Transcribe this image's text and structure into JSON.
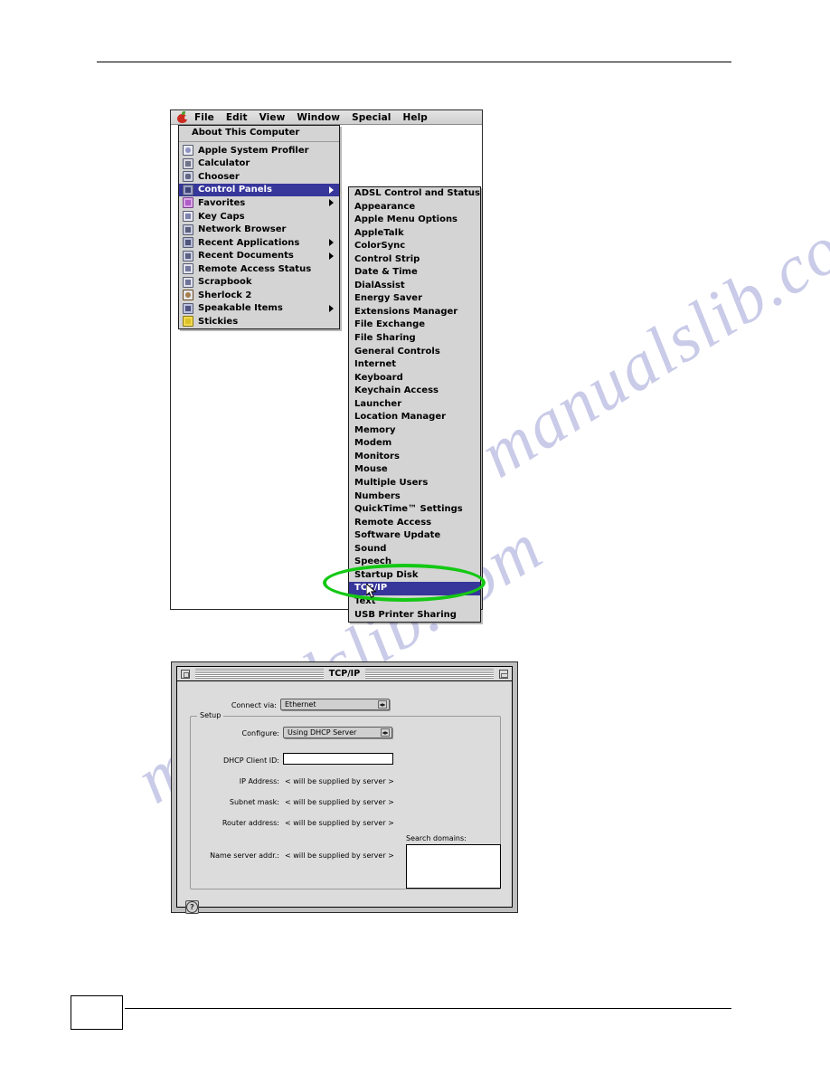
{
  "page": {
    "page_number": ""
  },
  "watermark": {
    "line1": "manualslib.com",
    "line2": "manualslib.com"
  },
  "mac_desktop": {
    "menubar": {
      "apple_icon": "apple-logo-icon",
      "items": [
        "File",
        "Edit",
        "View",
        "Window",
        "Special",
        "Help"
      ]
    },
    "apple_menu": {
      "header": "About This Computer",
      "items": [
        {
          "label": "Apple System Profiler",
          "icon": "profiler-icon",
          "submenu": false,
          "selected": false
        },
        {
          "label": "Calculator",
          "icon": "calculator-icon",
          "submenu": false,
          "selected": false
        },
        {
          "label": "Chooser",
          "icon": "chooser-icon",
          "submenu": false,
          "selected": false
        },
        {
          "label": "Control Panels",
          "icon": "control-panels-icon",
          "submenu": true,
          "selected": true
        },
        {
          "label": "Favorites",
          "icon": "favorites-icon",
          "submenu": true,
          "selected": false
        },
        {
          "label": "Key Caps",
          "icon": "key-caps-icon",
          "submenu": false,
          "selected": false
        },
        {
          "label": "Network Browser",
          "icon": "network-browser-icon",
          "submenu": false,
          "selected": false
        },
        {
          "label": "Recent Applications",
          "icon": "recent-applications-icon",
          "submenu": true,
          "selected": false
        },
        {
          "label": "Recent Documents",
          "icon": "recent-documents-icon",
          "submenu": true,
          "selected": false
        },
        {
          "label": "Remote Access Status",
          "icon": "remote-access-status-icon",
          "submenu": false,
          "selected": false
        },
        {
          "label": "Scrapbook",
          "icon": "scrapbook-icon",
          "submenu": false,
          "selected": false
        },
        {
          "label": "Sherlock 2",
          "icon": "sherlock-icon",
          "submenu": false,
          "selected": false
        },
        {
          "label": "Speakable Items",
          "icon": "speakable-items-icon",
          "submenu": true,
          "selected": false
        },
        {
          "label": "Stickies",
          "icon": "stickies-icon",
          "submenu": false,
          "selected": false
        }
      ]
    },
    "control_panels_submenu": {
      "items": [
        {
          "label": "ADSL Control and Status",
          "selected": false
        },
        {
          "label": "Appearance",
          "selected": false
        },
        {
          "label": "Apple Menu Options",
          "selected": false
        },
        {
          "label": "AppleTalk",
          "selected": false
        },
        {
          "label": "ColorSync",
          "selected": false
        },
        {
          "label": "Control Strip",
          "selected": false
        },
        {
          "label": "Date & Time",
          "selected": false
        },
        {
          "label": "DialAssist",
          "selected": false
        },
        {
          "label": "Energy Saver",
          "selected": false
        },
        {
          "label": "Extensions Manager",
          "selected": false
        },
        {
          "label": "File Exchange",
          "selected": false
        },
        {
          "label": "File Sharing",
          "selected": false
        },
        {
          "label": "General Controls",
          "selected": false
        },
        {
          "label": "Internet",
          "selected": false
        },
        {
          "label": "Keyboard",
          "selected": false
        },
        {
          "label": "Keychain Access",
          "selected": false
        },
        {
          "label": "Launcher",
          "selected": false
        },
        {
          "label": "Location Manager",
          "selected": false
        },
        {
          "label": "Memory",
          "selected": false
        },
        {
          "label": "Modem",
          "selected": false
        },
        {
          "label": "Monitors",
          "selected": false
        },
        {
          "label": "Mouse",
          "selected": false
        },
        {
          "label": "Multiple Users",
          "selected": false
        },
        {
          "label": "Numbers",
          "selected": false
        },
        {
          "label": "QuickTime™ Settings",
          "selected": false
        },
        {
          "label": "Remote Access",
          "selected": false
        },
        {
          "label": "Software Update",
          "selected": false
        },
        {
          "label": "Sound",
          "selected": false
        },
        {
          "label": "Speech",
          "selected": false
        },
        {
          "label": "Startup Disk",
          "selected": false
        },
        {
          "label": "TCP/IP",
          "selected": true
        },
        {
          "label": "Text",
          "selected": false
        },
        {
          "label": "USB Printer Sharing",
          "selected": false
        }
      ]
    },
    "annotation": {
      "highlight_color": "#14c814",
      "highlight_target": "TCP/IP",
      "cursor": "arrow-cursor"
    }
  },
  "tcpip_window": {
    "title": "TCP/IP",
    "close_box": "close-box-icon",
    "collapse_box": "collapse-box-icon",
    "connect_via": {
      "label": "Connect via:",
      "value": "Ethernet"
    },
    "setup_group_label": "Setup",
    "configure": {
      "label": "Configure:",
      "value": "Using DHCP Server"
    },
    "dhcp_client_id": {
      "label": "DHCP Client ID:",
      "value": ""
    },
    "ip_address": {
      "label": "IP Address:",
      "value": "< will be supplied by server >"
    },
    "subnet_mask": {
      "label": "Subnet mask:",
      "value": "< will be supplied by server >"
    },
    "router_address": {
      "label": "Router address:",
      "value": "< will be supplied by server >"
    },
    "name_server_addr": {
      "label": "Name server addr.:",
      "value": "< will be supplied by server >"
    },
    "search_domains": {
      "label": "Search domains:",
      "value": ""
    },
    "help_button": "help-question-icon"
  }
}
